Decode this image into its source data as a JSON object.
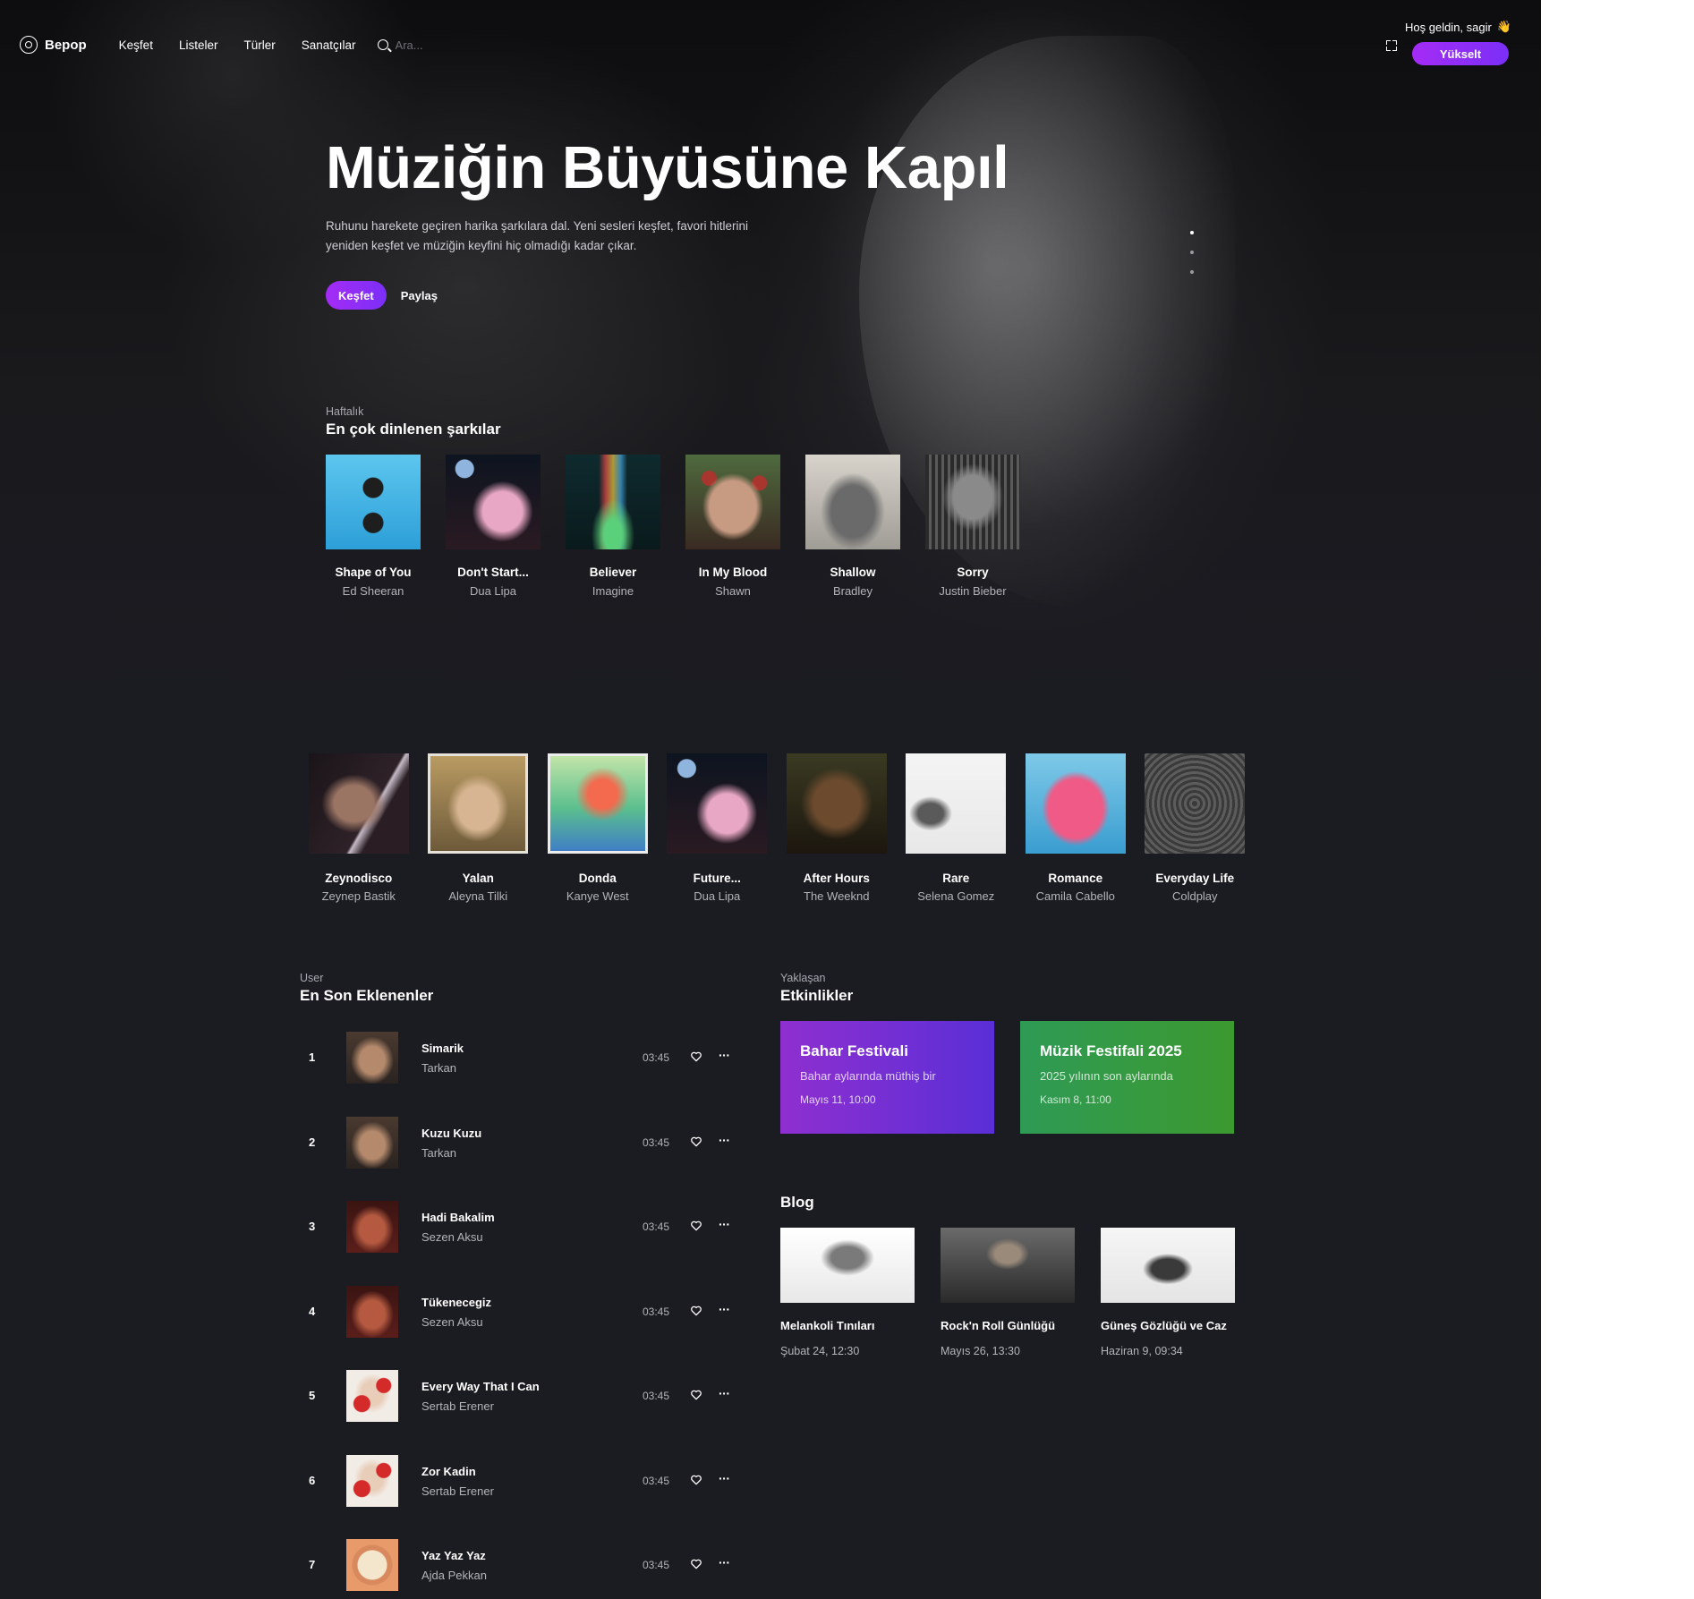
{
  "brand": "Bepop",
  "nav": {
    "items": [
      "Keşfet",
      "Listeler",
      "Türler",
      "Sanatçılar"
    ],
    "search_placeholder": "Ara..."
  },
  "user": {
    "welcome": "Hoş geldin, sagir",
    "wave_icon": "👋",
    "upgrade_label": "Yükselt"
  },
  "hero": {
    "title": "Müziğin Büyüsüne Kapıl",
    "description": "Ruhunu harekete geçiren harika şarkılara dal. Yeni sesleri keşfet, favori hitlerini yeniden keşfet ve müziğin keyfini hiç olmadığı kadar çıkar.",
    "primary_label": "Keşfet",
    "secondary_label": "Paylaş"
  },
  "weekly": {
    "subtitle": "Haftalık",
    "title": "En çok dinlenen şarkılar",
    "songs": [
      {
        "name": "Shape of You",
        "artist": "Ed Sheeran"
      },
      {
        "name": "Don't Start...",
        "artist": "Dua Lipa"
      },
      {
        "name": "Believer",
        "artist": "Imagine"
      },
      {
        "name": "In My Blood",
        "artist": "Shawn"
      },
      {
        "name": "Shallow",
        "artist": "Bradley"
      },
      {
        "name": "Sorry",
        "artist": "Justin Bieber"
      }
    ]
  },
  "albums": [
    {
      "name": "Zeynodisco",
      "artist": "Zeynep Bastik"
    },
    {
      "name": "Yalan",
      "artist": "Aleyna Tilki"
    },
    {
      "name": "Donda",
      "artist": "Kanye West"
    },
    {
      "name": "Future...",
      "artist": "Dua Lipa"
    },
    {
      "name": "After Hours",
      "artist": "The Weeknd"
    },
    {
      "name": "Rare",
      "artist": "Selena Gomez"
    },
    {
      "name": "Romance",
      "artist": "Camila Cabello"
    },
    {
      "name": "Everyday Life",
      "artist": "Coldplay"
    }
  ],
  "recent": {
    "subtitle": "User",
    "title": "En Son Eklenenler",
    "tracks": [
      {
        "num": "1",
        "name": "Simarik",
        "artist": "Tarkan",
        "duration": "03:45"
      },
      {
        "num": "2",
        "name": "Kuzu Kuzu",
        "artist": "Tarkan",
        "duration": "03:45"
      },
      {
        "num": "3",
        "name": "Hadi Bakalim",
        "artist": "Sezen Aksu",
        "duration": "03:45"
      },
      {
        "num": "4",
        "name": "Tükenecegiz",
        "artist": "Sezen Aksu",
        "duration": "03:45"
      },
      {
        "num": "5",
        "name": "Every Way That I Can",
        "artist": "Sertab Erener",
        "duration": "03:45"
      },
      {
        "num": "6",
        "name": "Zor Kadin",
        "artist": "Sertab Erener",
        "duration": "03:45"
      },
      {
        "num": "7",
        "name": "Yaz Yaz Yaz",
        "artist": "Ajda Pekkan",
        "duration": "03:45"
      }
    ]
  },
  "events": {
    "subtitle": "Yaklaşan",
    "title": "Etkinlikler",
    "items": [
      {
        "title": "Bahar Festivali",
        "desc": "Bahar aylarında müthiş bir",
        "date": "Mayıs 11, 10:00"
      },
      {
        "title": "Müzik Festifali 2025",
        "desc": "2025 yılının son aylarında",
        "date": "Kasım 8, 11:00"
      }
    ]
  },
  "blog": {
    "title": "Blog",
    "posts": [
      {
        "title": "Melankoli Tınıları",
        "date": "Şubat 24, 12:30"
      },
      {
        "title": "Rock'n Roll Günlüğü",
        "date": "Mayıs 26, 13:30"
      },
      {
        "title": "Güneş Gözlüğü ve Caz",
        "date": "Haziran 9, 09:34"
      }
    ]
  },
  "colors": {
    "accent": "#9b2ff5",
    "background": "#1b1b22",
    "event_purple": "#7a2fd3",
    "event_green": "#34994a"
  }
}
